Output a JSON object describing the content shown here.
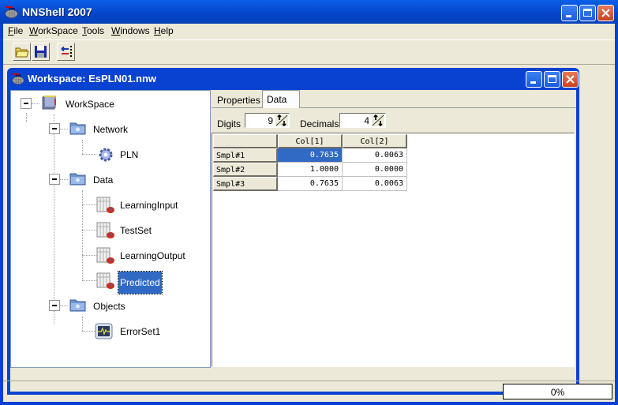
{
  "app": {
    "title": "NNShell 2007",
    "window_controls": [
      "minimize",
      "maximize",
      "close"
    ]
  },
  "menu": {
    "items": [
      {
        "label": "File",
        "accel": "F"
      },
      {
        "label": "WorkSpace",
        "accel": "W"
      },
      {
        "label": "Tools",
        "accel": "T"
      },
      {
        "label": "Windows",
        "accel": "W"
      },
      {
        "label": "Help",
        "accel": "H"
      }
    ]
  },
  "toolbar": {
    "buttons": [
      {
        "name": "open",
        "icon": "folder-open-icon"
      },
      {
        "name": "save",
        "icon": "floppy-disk-icon"
      },
      {
        "name": "transfer",
        "icon": "arrows-transfer-icon"
      }
    ]
  },
  "workspace_window": {
    "title": "Workspace: EsPLN01.nnw",
    "tree": {
      "root": {
        "label": "WorkSpace",
        "icon": "workspace-book-icon",
        "expanded": true
      },
      "nodes": [
        {
          "label": "Network",
          "icon": "folder-icon",
          "level": 1,
          "expanded": true
        },
        {
          "label": "PLN",
          "icon": "gear-icon",
          "level": 2
        },
        {
          "label": "Data",
          "icon": "folder-icon",
          "level": 1,
          "expanded": true
        },
        {
          "label": "LearningInput",
          "icon": "data-table-icon",
          "level": 2
        },
        {
          "label": "TestSet",
          "icon": "data-table-icon",
          "level": 2
        },
        {
          "label": "LearningOutput",
          "icon": "data-table-icon",
          "level": 2
        },
        {
          "label": "Predicted",
          "icon": "data-table-icon",
          "level": 2,
          "selected": true
        },
        {
          "label": "Objects",
          "icon": "folder-icon",
          "level": 1,
          "expanded": true
        },
        {
          "label": "ErrorSet1",
          "icon": "error-chart-icon",
          "level": 2
        }
      ]
    },
    "tabs": [
      {
        "label": "Properties",
        "active": false
      },
      {
        "label": "Data",
        "active": true
      }
    ],
    "digits": {
      "label": "Digits",
      "value": "9"
    },
    "decimals": {
      "label": "Decimals",
      "value": "4"
    },
    "grid": {
      "columns": [
        "Col[1]",
        "Col[2]"
      ],
      "rows": [
        {
          "label": "Smpl#1",
          "values": [
            "0.7635",
            "0.0063"
          ]
        },
        {
          "label": "Smpl#2",
          "values": [
            "1.0000",
            "0.0000"
          ]
        },
        {
          "label": "Smpl#3",
          "values": [
            "0.7635",
            "0.0063"
          ]
        }
      ],
      "selected_cell": {
        "row": 0,
        "col": 0
      }
    }
  },
  "status": {
    "progress_text": "0%"
  },
  "colors": {
    "titlebar": "#0a5fe8",
    "selection": "#316ac5",
    "face": "#ece9d8",
    "close_button": "#d4502c"
  }
}
